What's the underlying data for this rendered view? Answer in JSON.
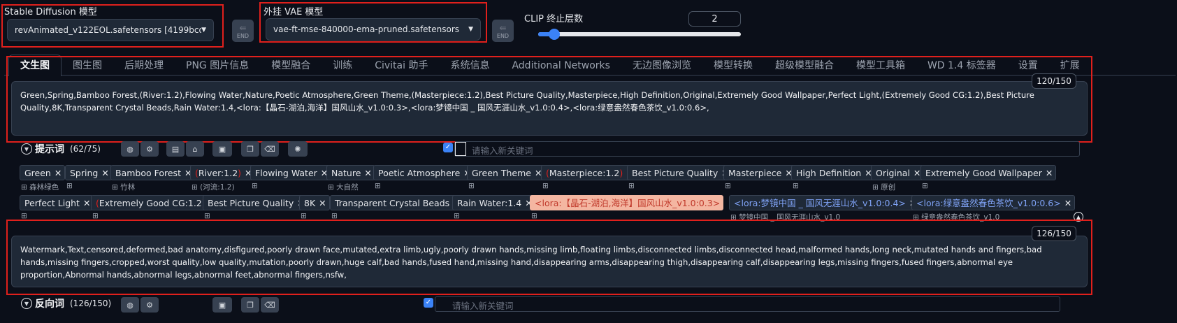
{
  "model": {
    "label": "Stable Diffusion 模型",
    "value": "revAnimated_v122EOL.safetensors [4199bcdd14"
  },
  "vae": {
    "label": "外挂 VAE 模型",
    "value": "vae-ft-mse-840000-ema-pruned.safetensors"
  },
  "clip": {
    "label": "CLIP 终止层数",
    "value": "2",
    "slider_fraction": 0.08
  },
  "refresh_label": "END",
  "tabs": [
    "文生图",
    "图生图",
    "后期处理",
    "PNG 图片信息",
    "模型融合",
    "训练",
    "Civitai 助手",
    "系统信息",
    "Additional Networks",
    "无边图像浏览",
    "模型转换",
    "超级模型融合",
    "模型工具箱",
    "WD 1.4 标签器",
    "设置",
    "扩展"
  ],
  "prompt": {
    "counter": "120/150",
    "text": "Green,Spring,Bamboo Forest,(River:1.2),Flowing Water,Nature,Poetic Atmosphere,Green Theme,(Masterpiece:1.2),Best Picture Quality,Masterpiece,High Definition,Original,Extremely Good Wallpaper,Perfect Light,(Extremely Good CG:1.2),Best Picture Quality,8K,Transparent Crystal Beads,Rain Water:1.4,<lora:【晶石-湖泊,海洋】国风山水_v1.0:0.3>,<lora:梦镜中国 _ 国风无涯山水_v1.0:0.4>,<lora:绿意盎然春色茶饮_v1.0:0.6>,"
  },
  "prompt_tools": {
    "title": "提示词",
    "count": "(62/75)",
    "keyword_placeholder": "请输入新关键词"
  },
  "chips_row1": [
    {
      "text": "Green",
      "sub": "森林绿色"
    },
    {
      "text": "Spring",
      "sub": ""
    },
    {
      "text": "Bamboo Forest",
      "sub": "竹林"
    },
    {
      "text": "River:1.2",
      "sub": "(河流:1.2)",
      "paren": true
    },
    {
      "text": "Flowing Water",
      "sub": ""
    },
    {
      "text": "Nature",
      "sub": "大自然"
    },
    {
      "text": "Poetic Atmosphere",
      "sub": ""
    },
    {
      "text": "Green Theme",
      "sub": ""
    },
    {
      "text": "Masterpiece:1.2",
      "sub": "",
      "paren": true
    },
    {
      "text": "Best Picture Quality",
      "sub": ""
    },
    {
      "text": "Masterpiece",
      "sub": ""
    },
    {
      "text": "High Definition",
      "sub": ""
    },
    {
      "text": "Original",
      "sub": "原创"
    },
    {
      "text": "Extremely Good Wallpaper",
      "sub": ""
    }
  ],
  "chips_row2": [
    {
      "text": "Perfect Light",
      "sub": ""
    },
    {
      "text": "Extremely Good CG:1.2",
      "sub": "",
      "paren": true
    },
    {
      "text": "Best Picture Quality",
      "sub": ""
    },
    {
      "text": "8K",
      "sub": ""
    },
    {
      "text": "Transparent Crystal Beads",
      "sub": ""
    },
    {
      "text": "Rain Water:1.4",
      "sub": ""
    },
    {
      "text": "<lora:【晶石-湖泊,海洋】国风山水_v1.0:0.3>",
      "sub": ""
    },
    {
      "text": "<lora:梦镜中国 _ 国风无涯山水_v1.0:0.4>",
      "sub": "梦镜中国 _ 国风无涯山水_v1.0"
    },
    {
      "text": "<lora:绿意盎然春色茶饮_v1.0:0.6>",
      "sub": "绿意盎然春色茶饮_v1.0"
    }
  ],
  "negative": {
    "counter": "126/150",
    "text": "Watermark,Text,censored,deformed,bad anatomy,disfigured,poorly drawn face,mutated,extra limb,ugly,poorly drawn hands,missing limb,floating limbs,disconnected limbs,disconnected head,malformed hands,long neck,mutated hands and fingers,bad hands,missing fingers,cropped,worst quality,low quality,mutation,poorly drawn,huge calf,bad hands,fused hand,missing hand,disappearing arms,disappearing thigh,disappearing calf,disappearing legs,missing fingers,fused fingers,abnormal eye proportion,Abnormal hands,abnormal legs,abnormal feet,abnormal fingers,nsfw,",
    "tools_title": "反向词",
    "tools_count": "(126/150)"
  },
  "colors": {
    "background": "#0b0f19",
    "highlight": "#e0201c",
    "accent": "#3b82f6",
    "lora_chip": "#f4b6a1"
  }
}
